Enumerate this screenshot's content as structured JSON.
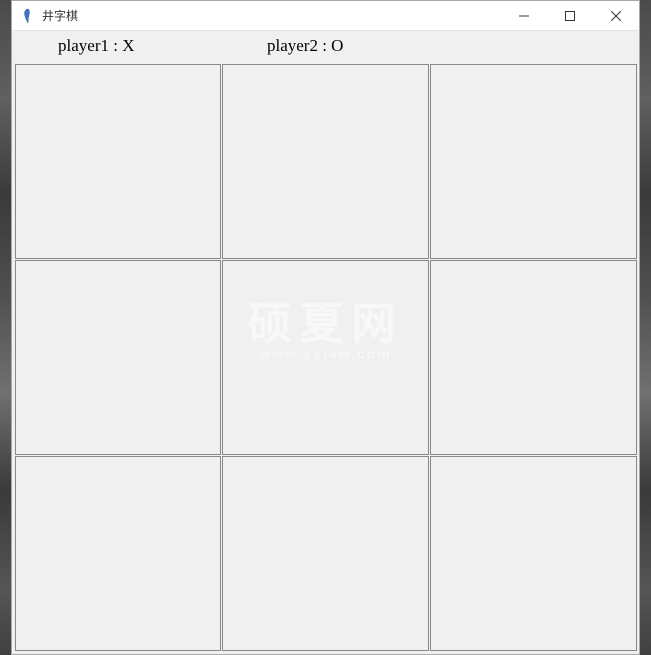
{
  "window": {
    "title": "井字棋"
  },
  "players": {
    "player1_label": "player1 : X",
    "player2_label": "player2 : O"
  },
  "board": {
    "cells": [
      "",
      "",
      "",
      "",
      "",
      "",
      "",
      "",
      ""
    ]
  },
  "watermark": {
    "main": "硕夏网",
    "sub": "www.sxiaw.com"
  }
}
